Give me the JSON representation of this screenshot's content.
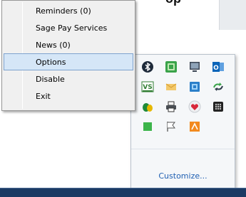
{
  "background": {
    "top_text": "op"
  },
  "context_menu": {
    "items": [
      {
        "label": "Reminders (0)",
        "highlighted": false
      },
      {
        "label": "Sage Pay Services",
        "highlighted": false
      },
      {
        "label": "News (0)",
        "highlighted": false
      },
      {
        "label": "Options",
        "highlighted": true
      },
      {
        "label": "Disable",
        "highlighted": false
      },
      {
        "label": "Exit",
        "highlighted": false
      }
    ]
  },
  "tray": {
    "icons": [
      "bluetooth-icon",
      "green-app-icon",
      "monitor-icon",
      "outlook-icon",
      "visual-studio-icon",
      "envelope-icon",
      "network-icon",
      "sync-arrows-icon",
      "leaf-icon",
      "printer-icon",
      "heart-icon",
      "dark-dots-icon",
      "green-square-icon",
      "flag-icon",
      "orange-app-icon"
    ],
    "customize_label": "Customize..."
  },
  "colors": {
    "menu_highlight": "#d5e6f7",
    "link": "#1f5fb2",
    "taskbar": "#1b3a63"
  }
}
